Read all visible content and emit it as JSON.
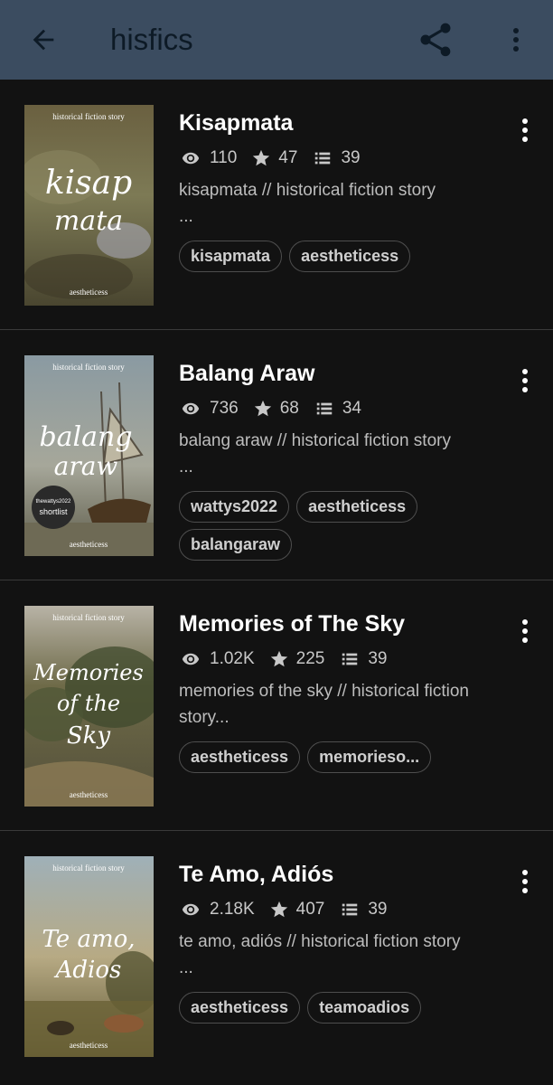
{
  "appbar": {
    "title": "hisfics"
  },
  "stories": [
    {
      "title": "Kisapmata",
      "reads": "110",
      "votes": "47",
      "parts": "39",
      "description": "kisapmata // historical fiction story",
      "description2": "...",
      "tags": [
        "kisapmata",
        "aestheticess"
      ],
      "cover": {
        "top": "historical fiction story",
        "line1": "kisap",
        "line2": "mata",
        "author": "aestheticess"
      }
    },
    {
      "title": "Balang Araw",
      "reads": "736",
      "votes": "68",
      "parts": "34",
      "description": "balang araw // historical fiction story",
      "description2": "...",
      "tags": [
        "wattys2022",
        "aestheticess",
        "balangaraw"
      ],
      "cover": {
        "top": "historical fiction story",
        "line1": "balang",
        "line2": "araw",
        "author": "aestheticess",
        "badge_top": "thewattys2022",
        "badge_bottom": "shortlist"
      }
    },
    {
      "title": "Memories of The Sky",
      "reads": "1.02K",
      "votes": "225",
      "parts": "39",
      "description": "memories of the sky // historical fiction",
      "description2": "story...",
      "tags": [
        "aestheticess",
        "memorieso..."
      ],
      "cover": {
        "top": "historical fiction story",
        "line1": "Memories",
        "line2": "of the",
        "line3": "Sky",
        "author": "aestheticess"
      }
    },
    {
      "title": "Te Amo, Adiós",
      "reads": "2.18K",
      "votes": "407",
      "parts": "39",
      "description": "te amo, adiós // historical fiction story",
      "description2": "...",
      "tags": [
        "aestheticess",
        "teamoadios"
      ],
      "cover": {
        "top": "historical fiction story",
        "line1": "Te amo,",
        "line2": "Adios",
        "author": "aestheticess"
      }
    }
  ],
  "colors": {
    "appbar": "#3b4c60",
    "background": "#121212"
  },
  "icons": [
    "back-arrow-icon",
    "share-icon",
    "more-vert-icon",
    "eye-icon",
    "star-icon",
    "list-icon"
  ]
}
